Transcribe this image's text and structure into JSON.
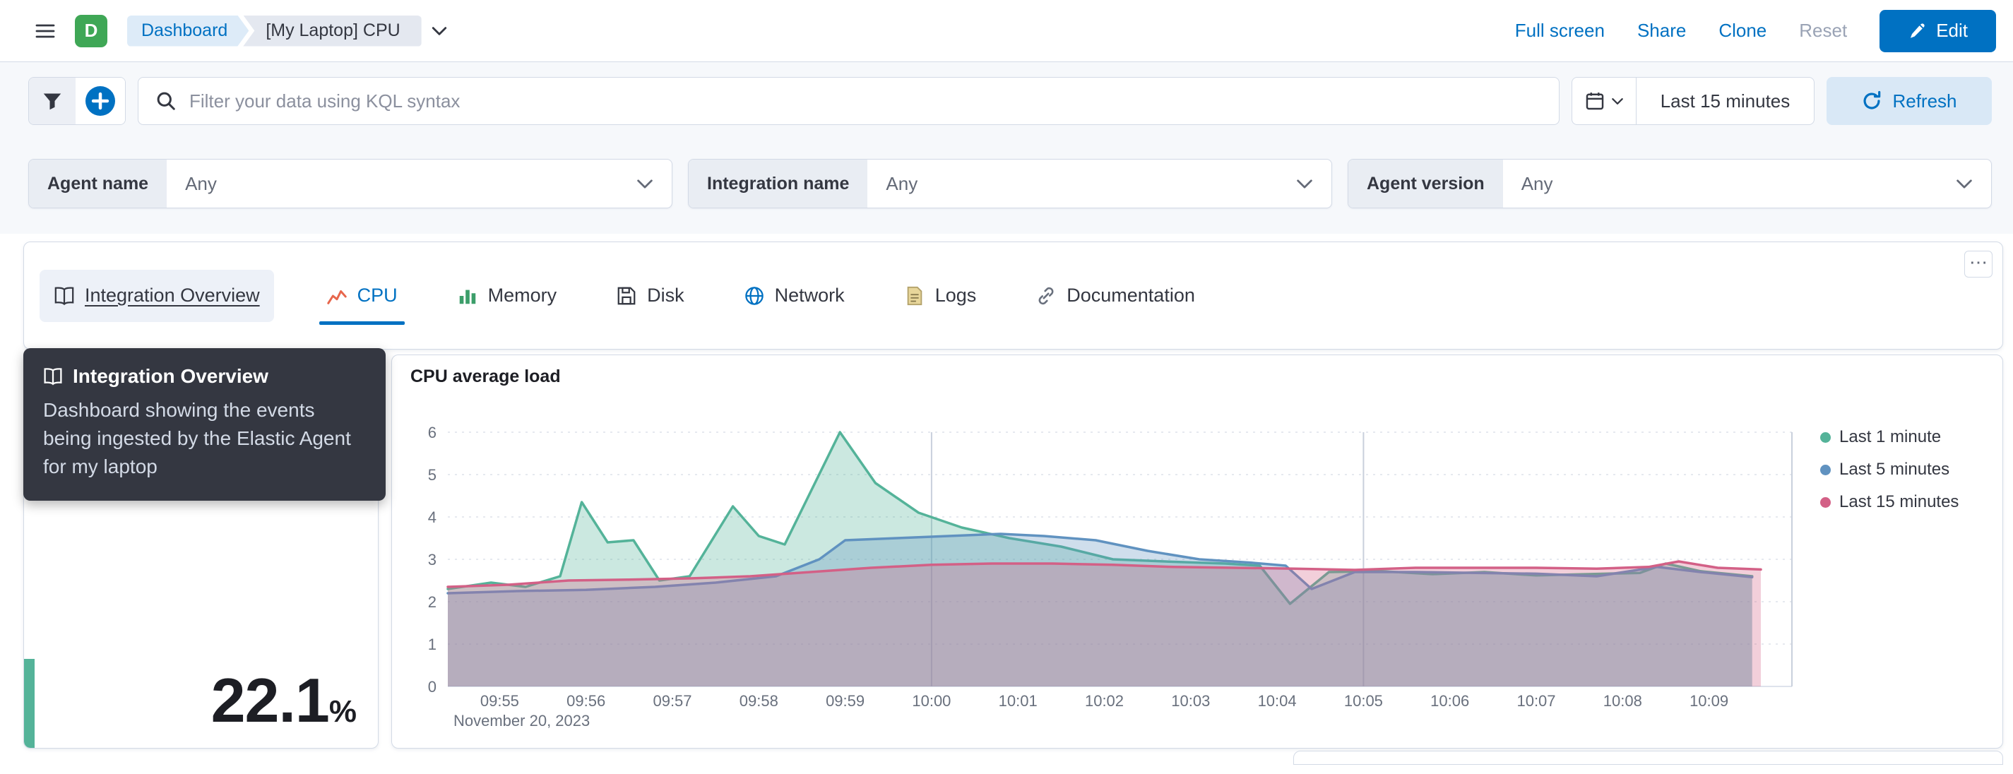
{
  "header": {
    "space_initial": "D",
    "breadcrumbs": [
      {
        "label": "Dashboard"
      },
      {
        "label": "[My Laptop] CPU"
      }
    ],
    "actions": {
      "full_screen": "Full screen",
      "share": "Share",
      "clone": "Clone",
      "reset": "Reset",
      "edit": "Edit"
    }
  },
  "filter_bar": {
    "search_placeholder": "Filter your data using KQL syntax",
    "time_range": "Last 15 minutes",
    "refresh_label": "Refresh"
  },
  "controls": [
    {
      "label": "Agent name",
      "value": "Any"
    },
    {
      "label": "Integration name",
      "value": "Any"
    },
    {
      "label": "Agent version",
      "value": "Any"
    }
  ],
  "tabs": [
    {
      "label": "Integration Overview",
      "icon": "book-icon",
      "state": "hovered"
    },
    {
      "label": "CPU",
      "icon": "line-chart-icon",
      "state": "selected"
    },
    {
      "label": "Memory",
      "icon": "bar-chart-icon",
      "state": "normal"
    },
    {
      "label": "Disk",
      "icon": "disk-icon",
      "state": "normal"
    },
    {
      "label": "Network",
      "icon": "globe-icon",
      "state": "normal"
    },
    {
      "label": "Logs",
      "icon": "document-icon",
      "state": "normal"
    },
    {
      "label": "Documentation",
      "icon": "link-icon",
      "state": "normal"
    }
  ],
  "panel_options_glyph": "⋯",
  "tooltip": {
    "title": "Integration Overview",
    "body": "Dashboard showing the events being ingested by the Elastic Agent for my laptop"
  },
  "metric_panel": {
    "value": "22.1",
    "unit": "%"
  },
  "chart_panel": {
    "title": "CPU average load"
  },
  "colors": {
    "primary": "#0071c2",
    "tooltip_bg": "#343741",
    "panel_border": "#d3dae6",
    "series_green": "#54B399",
    "series_blue": "#6092C0",
    "series_pink": "#D36086",
    "metric_accent": "#54B399"
  },
  "chart_data": {
    "type": "area",
    "title": "CPU average load",
    "x_axis": {
      "tick_labels": [
        "09:55",
        "09:56",
        "09:57",
        "09:58",
        "09:59",
        "10:00",
        "10:01",
        "10:02",
        "10:03",
        "10:04",
        "10:05",
        "10:06",
        "10:07",
        "10:08",
        "10:09"
      ],
      "tick_minutes": [
        1,
        2,
        3,
        4,
        5,
        6,
        7,
        8,
        9,
        10,
        11,
        12,
        13,
        14,
        15
      ],
      "domain_minutes": [
        0.4,
        15.96
      ],
      "date_label": "November 20, 2023"
    },
    "y_axis": {
      "ticks": [
        0,
        1,
        2,
        3,
        4,
        5,
        6
      ],
      "range": [
        0,
        6
      ]
    },
    "grid": {
      "horizontal": "dashed",
      "vertical_emphasis_minutes": [
        6,
        11
      ]
    },
    "legend": {
      "position": "right",
      "entries": [
        {
          "label": "Last 1 minute",
          "color": "#54B399"
        },
        {
          "label": "Last 5 minutes",
          "color": "#6092C0"
        },
        {
          "label": "Last 15 minutes",
          "color": "#D36086"
        }
      ]
    },
    "series": [
      {
        "name": "Last 1 minute",
        "color": "#54B399",
        "points": [
          [
            0.4,
            2.3
          ],
          [
            0.9,
            2.45
          ],
          [
            1.3,
            2.35
          ],
          [
            1.7,
            2.6
          ],
          [
            1.95,
            4.35
          ],
          [
            2.25,
            3.4
          ],
          [
            2.55,
            3.45
          ],
          [
            2.85,
            2.5
          ],
          [
            3.2,
            2.6
          ],
          [
            3.7,
            4.25
          ],
          [
            4.0,
            3.55
          ],
          [
            4.3,
            3.35
          ],
          [
            4.94,
            6.0
          ],
          [
            5.35,
            4.8
          ],
          [
            5.85,
            4.1
          ],
          [
            6.35,
            3.75
          ],
          [
            6.9,
            3.5
          ],
          [
            7.5,
            3.3
          ],
          [
            8.1,
            3.0
          ],
          [
            8.7,
            2.95
          ],
          [
            9.4,
            2.9
          ],
          [
            9.8,
            2.85
          ],
          [
            10.15,
            1.95
          ],
          [
            10.6,
            2.7
          ],
          [
            11.2,
            2.72
          ],
          [
            11.8,
            2.65
          ],
          [
            12.4,
            2.7
          ],
          [
            13.0,
            2.62
          ],
          [
            13.6,
            2.65
          ],
          [
            14.2,
            2.68
          ],
          [
            14.5,
            2.9
          ],
          [
            14.9,
            2.72
          ],
          [
            15.5,
            2.6
          ]
        ]
      },
      {
        "name": "Last 5 minutes",
        "color": "#6092C0",
        "points": [
          [
            0.4,
            2.2
          ],
          [
            1.2,
            2.25
          ],
          [
            2.0,
            2.28
          ],
          [
            2.8,
            2.35
          ],
          [
            3.5,
            2.45
          ],
          [
            4.2,
            2.6
          ],
          [
            4.7,
            3.0
          ],
          [
            5.0,
            3.45
          ],
          [
            5.6,
            3.5
          ],
          [
            6.2,
            3.55
          ],
          [
            6.8,
            3.6
          ],
          [
            7.3,
            3.55
          ],
          [
            7.9,
            3.45
          ],
          [
            8.5,
            3.2
          ],
          [
            9.1,
            3.0
          ],
          [
            9.7,
            2.92
          ],
          [
            10.1,
            2.85
          ],
          [
            10.4,
            2.3
          ],
          [
            10.9,
            2.7
          ],
          [
            11.6,
            2.7
          ],
          [
            12.3,
            2.68
          ],
          [
            13.0,
            2.66
          ],
          [
            13.7,
            2.6
          ],
          [
            14.4,
            2.82
          ],
          [
            14.9,
            2.7
          ],
          [
            15.5,
            2.58
          ]
        ]
      },
      {
        "name": "Last 15 minutes",
        "color": "#D36086",
        "points": [
          [
            0.4,
            2.35
          ],
          [
            1.1,
            2.4
          ],
          [
            1.8,
            2.5
          ],
          [
            2.5,
            2.52
          ],
          [
            3.2,
            2.55
          ],
          [
            3.9,
            2.6
          ],
          [
            4.6,
            2.7
          ],
          [
            5.3,
            2.8
          ],
          [
            6.0,
            2.87
          ],
          [
            6.7,
            2.9
          ],
          [
            7.4,
            2.9
          ],
          [
            8.1,
            2.87
          ],
          [
            8.8,
            2.82
          ],
          [
            9.5,
            2.8
          ],
          [
            10.2,
            2.78
          ],
          [
            10.9,
            2.75
          ],
          [
            11.6,
            2.8
          ],
          [
            12.3,
            2.8
          ],
          [
            13.0,
            2.8
          ],
          [
            13.7,
            2.78
          ],
          [
            14.3,
            2.82
          ],
          [
            14.65,
            2.95
          ],
          [
            15.1,
            2.8
          ],
          [
            15.6,
            2.76
          ]
        ]
      }
    ]
  }
}
